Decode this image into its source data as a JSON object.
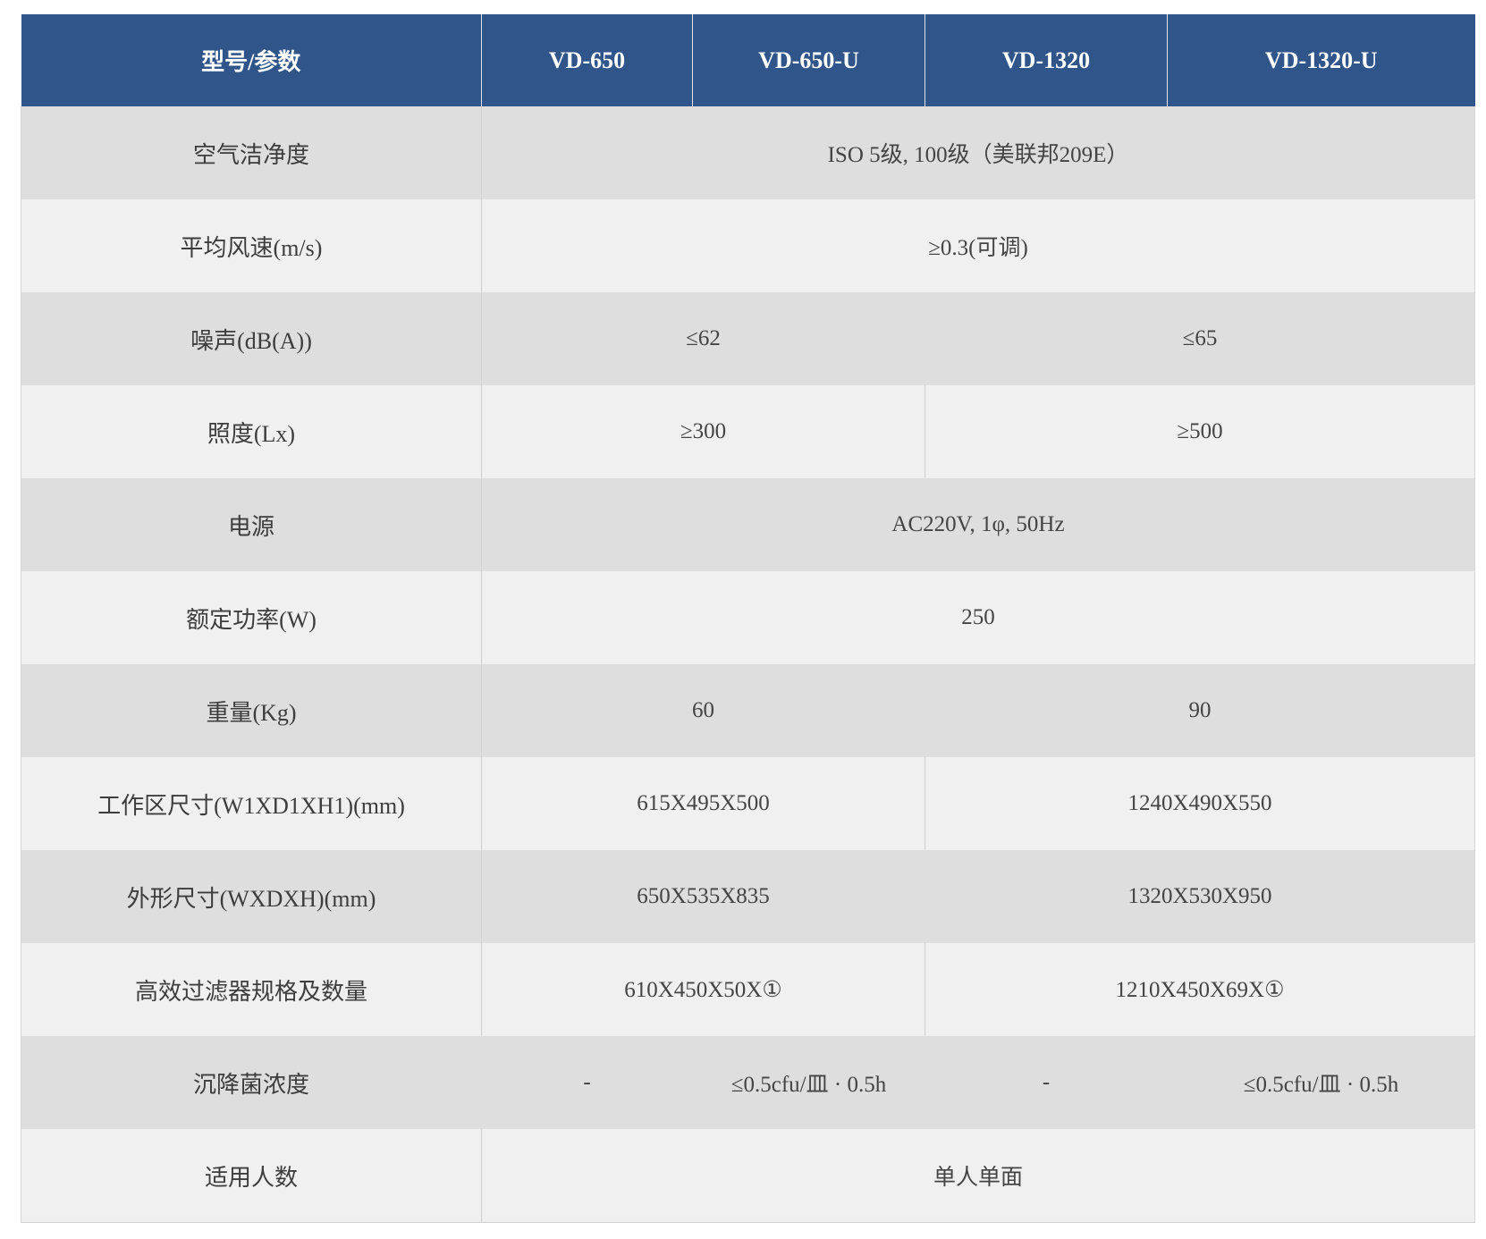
{
  "header": {
    "param_label": "型号/参数",
    "models": [
      "VD-650",
      "VD-650-U",
      "VD-1320",
      "VD-1320-U"
    ]
  },
  "rows": {
    "cleanliness": {
      "label": "空气洁净度",
      "value": "ISO 5级, 100级（美联邦209E）"
    },
    "wind_speed": {
      "label": "平均风速(m/s)",
      "value": "≥0.3(可调)"
    },
    "noise": {
      "label": "噪声(dB(A))",
      "small": "≤62",
      "large": "≤65"
    },
    "illumination": {
      "label": "照度(Lx)",
      "small": "≥300",
      "large": "≥500"
    },
    "power_supply": {
      "label": "电源",
      "value": "AC220V, 1φ, 50Hz"
    },
    "rated_power": {
      "label": "额定功率(W)",
      "value": "250"
    },
    "weight": {
      "label": "重量(Kg)",
      "small": "60",
      "large": "90"
    },
    "work_area": {
      "label": "工作区尺寸(W1XD1XH1)(mm)",
      "small": "615X495X500",
      "large": "1240X490X550"
    },
    "outer_size": {
      "label": "外形尺寸(WXDXH)(mm)",
      "small": "650X535X835",
      "large": "1320X530X950"
    },
    "hepa": {
      "label": "高效过滤器规格及数量",
      "small": "610X450X50X①",
      "large": "1210X450X69X①"
    },
    "bacteria": {
      "label": "沉降菌浓度",
      "values": [
        "-",
        "≤0.5cfu/皿 · 0.5h",
        "-",
        "≤0.5cfu/皿 · 0.5h"
      ]
    },
    "users": {
      "label": "适用人数",
      "value": "单人单面"
    }
  }
}
